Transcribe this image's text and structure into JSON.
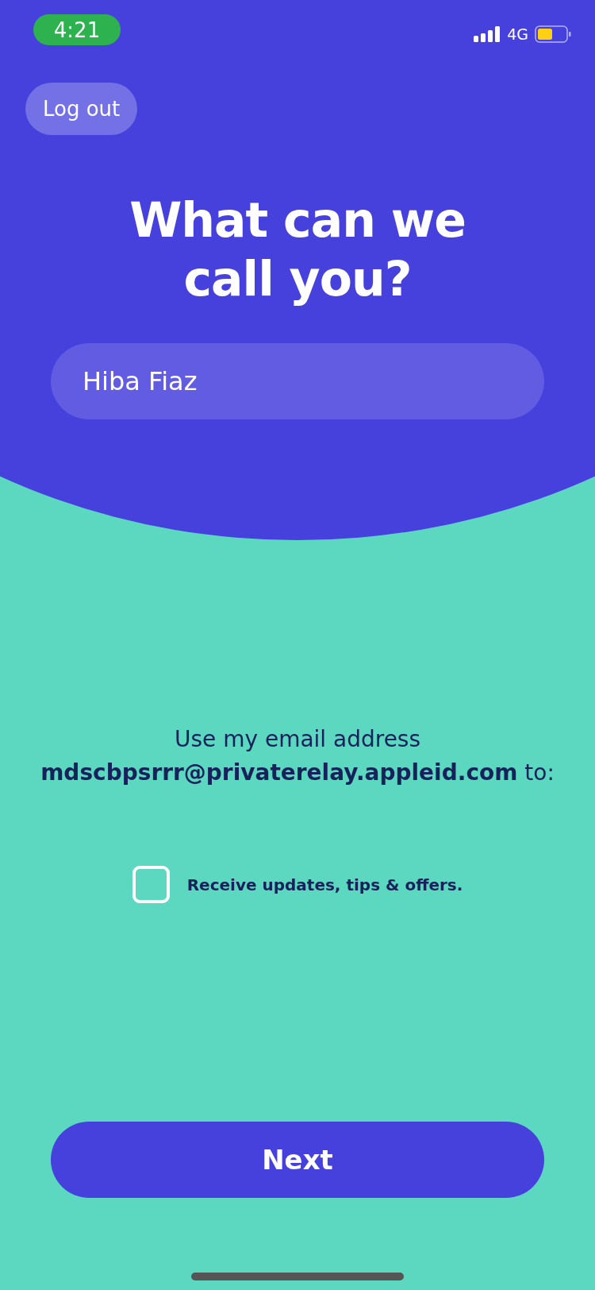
{
  "status_bar": {
    "time": "4:21",
    "network": "4G"
  },
  "logout_button": {
    "label": "Log out"
  },
  "title": "What can we call you?",
  "name_field": {
    "value": "Hiba Fiaz"
  },
  "email_notice": "Use my email address **mdscbpsrrr@privaterelay.appleid.com** to:",
  "consent": {
    "label": "Receive updates, tips & offers.",
    "checked": false
  },
  "next_button": {
    "label": "Next"
  }
}
